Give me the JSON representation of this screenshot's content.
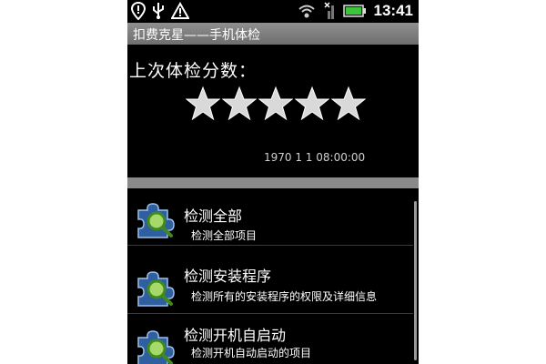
{
  "status_bar": {
    "time": "13:41",
    "left_icons": [
      "location-pin-icon",
      "usb-icon",
      "warning-icon"
    ],
    "right_icons": [
      "wifi-icon",
      "no-signal-icon",
      "battery-icon"
    ],
    "battery_color": "#3cc43c"
  },
  "app": {
    "title": "扣费克星——手机体检"
  },
  "score": {
    "label": "上次体检分数：",
    "stars_total": 5,
    "stars_filled": 5,
    "date": "1970 1 1 08:00:00"
  },
  "list": {
    "items": [
      {
        "title": "检测全部",
        "subtitle": "检测全部项目",
        "icon": "puzzle-magnifier-icon"
      },
      {
        "title": "检测安装程序",
        "subtitle": "检测所有的安装程序的权限及详细信息",
        "icon": "puzzle-magnifier-icon"
      },
      {
        "title": "检测开机自启动",
        "subtitle": "检测开机自动启动的项目",
        "icon": "puzzle-magnifier-icon"
      }
    ]
  }
}
